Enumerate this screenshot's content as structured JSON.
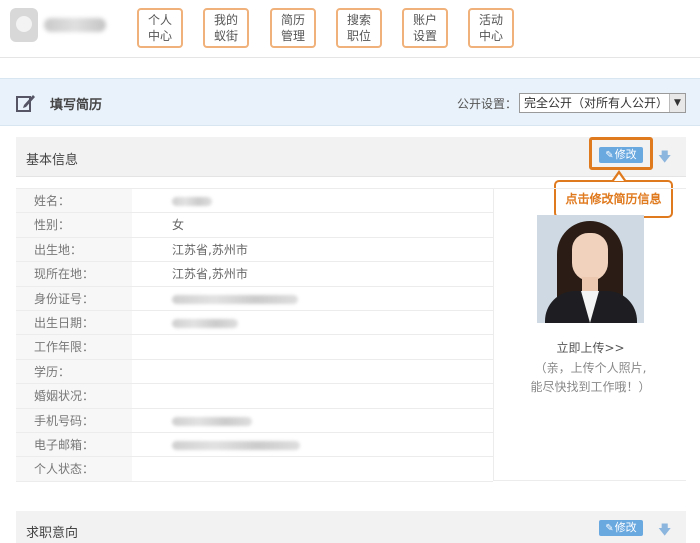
{
  "header": {
    "nav": [
      {
        "line1": "个人",
        "line2": "中心"
      },
      {
        "line1": "我的",
        "line2": "蚁街"
      },
      {
        "line1": "简历",
        "line2": "管理"
      },
      {
        "line1": "搜索",
        "line2": "职位"
      },
      {
        "line1": "账户",
        "line2": "设置"
      },
      {
        "line1": "活动",
        "line2": "中心"
      }
    ]
  },
  "title_bar": {
    "title": "填写简历",
    "privacy_label": "公开设置：",
    "privacy_value": "完全公开（对所有人公开）"
  },
  "basic_info": {
    "title": "基本信息",
    "edit_label": "修改",
    "callout": "点击修改简历信息",
    "rows": [
      {
        "label": "姓名：",
        "value": ""
      },
      {
        "label": "性别：",
        "value": "女"
      },
      {
        "label": "出生地：",
        "value": "江苏省,苏州市"
      },
      {
        "label": "现所在地：",
        "value": "江苏省,苏州市"
      },
      {
        "label": "身份证号：",
        "value": ""
      },
      {
        "label": "出生日期：",
        "value": ""
      },
      {
        "label": "工作年限：",
        "value": ""
      },
      {
        "label": "学历：",
        "value": ""
      },
      {
        "label": "婚姻状况：",
        "value": ""
      },
      {
        "label": "手机号码：",
        "value": ""
      },
      {
        "label": "电子邮箱：",
        "value": ""
      },
      {
        "label": "个人状态：",
        "value": ""
      }
    ],
    "upload_link": "立即上传>>",
    "upload_tip_1": "（亲，上传个人照片,",
    "upload_tip_2": "能尽快找到工作哦！）"
  },
  "job_intent": {
    "title": "求职意向",
    "edit_label": "修改"
  },
  "icons": {
    "edit_title": "pencil-note-icon",
    "edit_button": "pen-icon",
    "expand": "down-arrow-icon",
    "select": "dropdown-arrow-icon"
  },
  "colors": {
    "accent_orange": "#e07a1f",
    "nav_border": "#f0b27a",
    "button_blue": "#6aa8e0",
    "title_bar_bg": "#e9f2fa"
  }
}
